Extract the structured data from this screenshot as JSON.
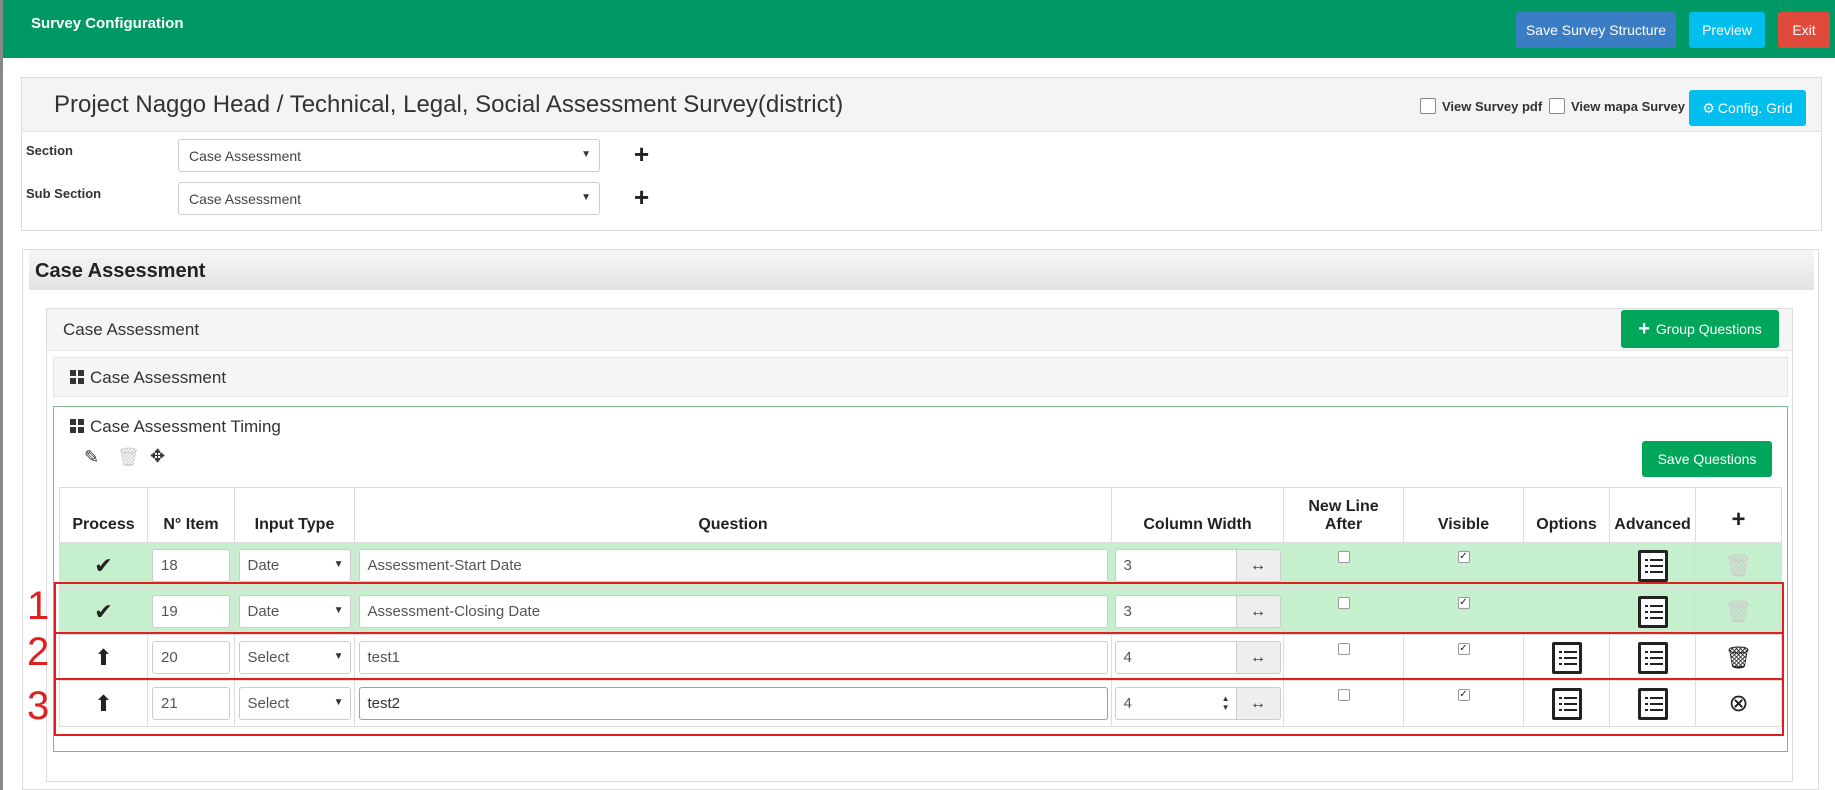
{
  "topbar": {
    "title": "Survey Configuration",
    "save_structure": "Save Survey Structure",
    "preview": "Preview",
    "exit": "Exit",
    "colors": {
      "bar": "#009966",
      "primary": "#3a7dc4",
      "info": "#00bfef",
      "danger": "#e04a3a"
    }
  },
  "project": {
    "title": "Project Naggo Head / Technical, Legal, Social Assessment Survey(district)",
    "view_pdf": "View Survey pdf",
    "view_mapa": "View mapa Survey",
    "config_grid": "Config. Grid",
    "section_label": "Section",
    "section_value": "Case Assessment",
    "subsection_label": "Sub Section",
    "subsection_value": "Case Assessment"
  },
  "case": {
    "heading": "Case Assessment",
    "group_title": "Case Assessment",
    "group_questions": "Group Questions",
    "sub1_title": "Case Assessment",
    "sub2_title": "Case Assessment Timing",
    "save_questions": "Save Questions"
  },
  "table": {
    "headers": {
      "process": "Process",
      "item": "N° Item",
      "input_type": "Input Type",
      "question": "Question",
      "column_width": "Column Width",
      "new_line_after": "New Line After",
      "visible": "Visible",
      "options": "Options",
      "advanced": "Advanced",
      "add": "+"
    },
    "rows": [
      {
        "item": "18",
        "input_type": "Date",
        "question": "Assessment-Start Date",
        "width": "3",
        "new_line": false,
        "visible": true,
        "saved": true
      },
      {
        "item": "19",
        "input_type": "Date",
        "question": "Assessment-Closing Date",
        "width": "3",
        "new_line": false,
        "visible": true,
        "saved": true
      },
      {
        "item": "20",
        "input_type": "Select",
        "question": "test1",
        "width": "4",
        "new_line": false,
        "visible": true,
        "saved": false
      },
      {
        "item": "21",
        "input_type": "Select",
        "question": "test2",
        "width": "4",
        "new_line": false,
        "visible": true,
        "saved": false
      }
    ]
  },
  "annotations": [
    "1",
    "2",
    "3"
  ]
}
